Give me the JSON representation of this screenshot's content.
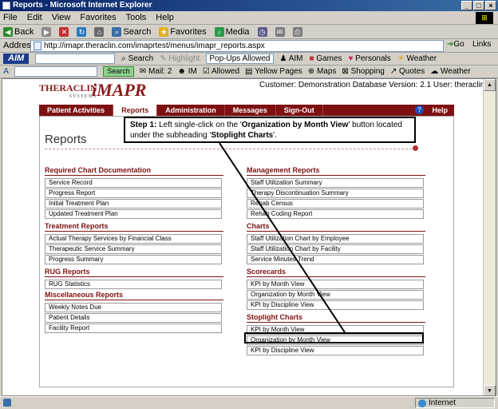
{
  "window": {
    "title": "Reports - Microsoft Internet Explorer"
  },
  "menu": [
    "File",
    "Edit",
    "View",
    "Favorites",
    "Tools",
    "Help"
  ],
  "toolbar": {
    "back": "Back",
    "search": "Search",
    "favorites": "Favorites",
    "media": "Media"
  },
  "address": {
    "label": "Address",
    "url": "http://imapr.theraclin.com/imaprtest/menus/imapr_reports.aspx",
    "go": "Go",
    "links": "Links"
  },
  "aim_bar": {
    "logo": "AIM",
    "search": "Search",
    "highlight": "Highlight",
    "popups": "Pop-Ups Allowed",
    "aim": "AIM",
    "games": "Games",
    "personals": "Personals",
    "weather": "Weather"
  },
  "google_bar": {
    "search": "Search",
    "mail": "Mail: 2",
    "im": "IM",
    "allowed": "Allowed",
    "yellow_pages": "Yellow Pages",
    "maps": "Maps",
    "shopping": "Shopping",
    "quotes": "Quotes",
    "weather": "Weather"
  },
  "app": {
    "logo_thera": "THERACLIN",
    "logo_sub": "SYSTEMS",
    "logo_imapr": "iMAPR",
    "customer_line": "Customer: Demonstration Database Version: 2.1 User: theraclin",
    "nav": [
      "Patient Activities",
      "Reports",
      "Administration",
      "Messages",
      "Sign-Out"
    ],
    "help": "Help",
    "page_title": "Reports"
  },
  "sections": {
    "required": {
      "title": "Required Chart Documentation",
      "items": [
        "Service Record",
        "Progress Report",
        "Initial Treatment Plan",
        "Updated Treatment Plan"
      ]
    },
    "treatment": {
      "title": "Treatment Reports",
      "items": [
        "Actual Therapy Services by Financial Class",
        "Therapeutic Service Summary",
        "Progress Summary"
      ]
    },
    "rug": {
      "title": "RUG Reports",
      "items": [
        "RUG Statistics"
      ]
    },
    "misc": {
      "title": "Miscellaneous Reports",
      "items": [
        "Weekly Notes Due",
        "Patient Details",
        "Facility Report"
      ]
    },
    "management": {
      "title": "Management Reports",
      "items": [
        "Staff Utilization Summary",
        "Therapy Discontinuation Summary",
        "Rehab Census",
        "Rehab Coding Report"
      ]
    },
    "charts": {
      "title": "Charts",
      "items": [
        "Staff Utilization Chart by Employee",
        "Staff Utilization Chart by Facility",
        "Service Minutes Trend"
      ]
    },
    "scorecards": {
      "title": "Scorecards",
      "items": [
        "KPI by Month View",
        "Organization by Month View",
        "KPI by Discipline View"
      ]
    },
    "stoplight": {
      "title": "Stoplight Charts",
      "items": [
        "KPI by Month View",
        "Organization by Month View",
        "KPI by Discipline View"
      ]
    }
  },
  "callout": {
    "step": "Step 1:",
    "text1": " Left single-click on the '",
    "target": "Organization by Month View",
    "text2": "' button located under the subheading '",
    "sub": "Stoplight Charts",
    "text3": "'."
  },
  "status": {
    "zone": "Internet"
  }
}
